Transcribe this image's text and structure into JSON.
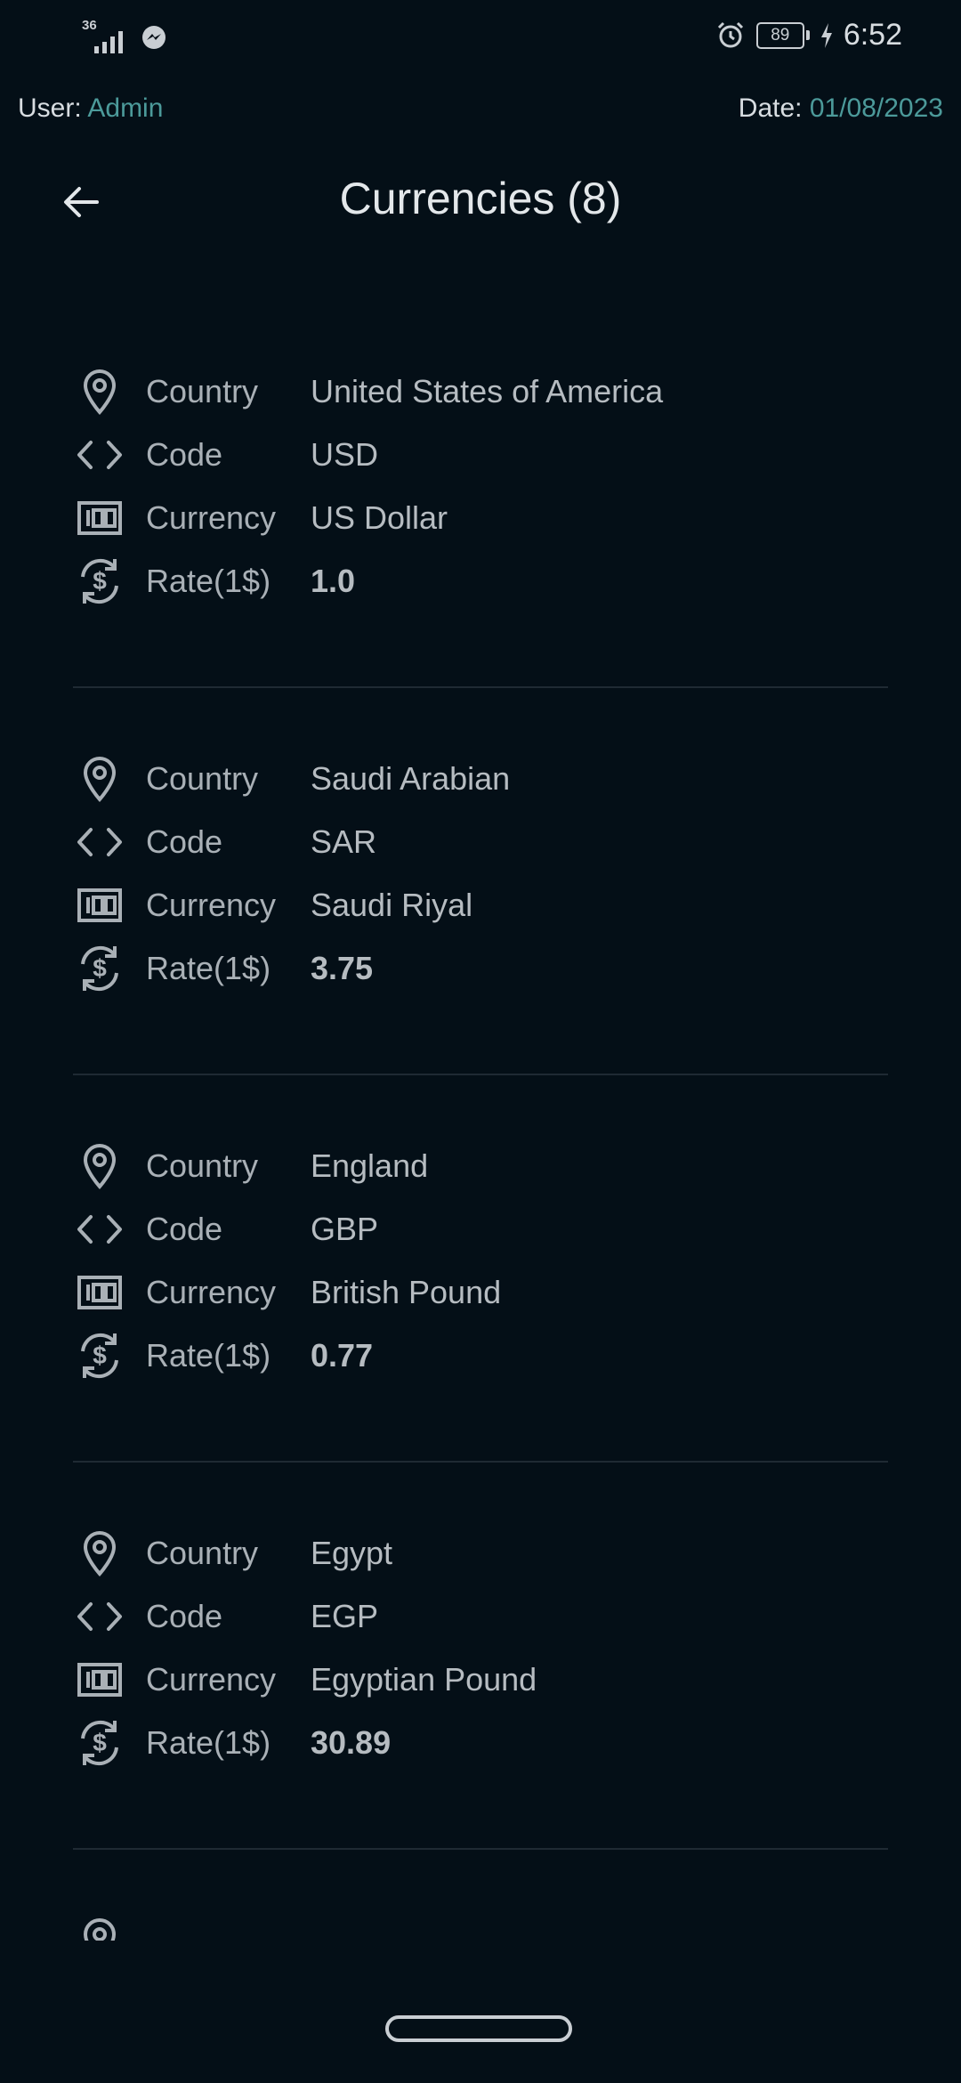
{
  "status_bar": {
    "network": "36",
    "time": "6:52",
    "battery": "89"
  },
  "info": {
    "user_label": "User:",
    "user_value": "Admin",
    "date_label": "Date:",
    "date_value": "01/08/2023"
  },
  "header": {
    "title": "Currencies (8)"
  },
  "labels": {
    "country": "Country",
    "code": "Code",
    "currency": "Currency",
    "rate": "Rate(1$)"
  },
  "currencies": [
    {
      "country": "United States of America",
      "code": "USD",
      "currency": "US Dollar",
      "rate": "1.0"
    },
    {
      "country": "Saudi Arabian",
      "code": "SAR",
      "currency": "Saudi Riyal",
      "rate": "3.75"
    },
    {
      "country": "England",
      "code": "GBP",
      "currency": "British Pound",
      "rate": "0.77"
    },
    {
      "country": "Egypt",
      "code": "EGP",
      "currency": "Egyptian Pound",
      "rate": "30.89"
    }
  ],
  "colors": {
    "background": "#040f17",
    "accent": "#4c9a9a"
  }
}
